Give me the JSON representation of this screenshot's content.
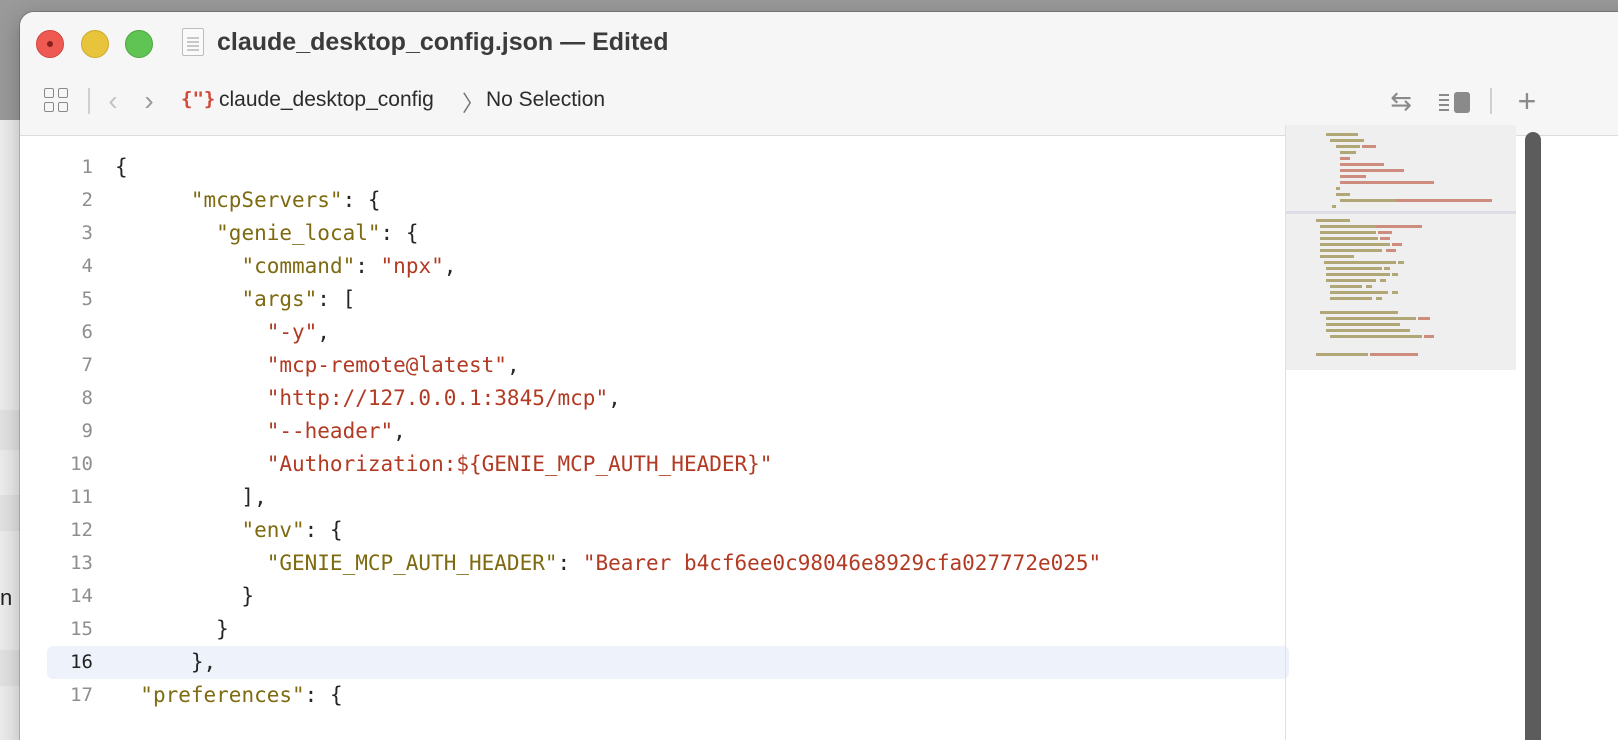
{
  "window": {
    "title": "claude_desktop_config.json — Edited"
  },
  "toolbar": {
    "back_glyph": "‹",
    "forward_glyph": "›",
    "breadcrumb": {
      "file_icon_glyph": "{\"}",
      "file": "claude_desktop_config",
      "separator": "〉",
      "selection": "No Selection"
    },
    "add_glyph": "+",
    "swap_glyph": "⇆"
  },
  "background": {
    "partial_char": "n"
  },
  "editor": {
    "current_line": 16,
    "lines": [
      {
        "n": "1",
        "text": "{"
      },
      {
        "n": "2",
        "text": "      \"mcpServers\": {"
      },
      {
        "n": "3",
        "text": "        \"genie_local\": {"
      },
      {
        "n": "4",
        "text": "          \"command\": \"npx\","
      },
      {
        "n": "5",
        "text": "          \"args\": ["
      },
      {
        "n": "6",
        "text": "            \"-y\","
      },
      {
        "n": "7",
        "text": "            \"mcp-remote@latest\","
      },
      {
        "n": "8",
        "text": "            \"http://127.0.0.1:3845/mcp\","
      },
      {
        "n": "9",
        "text": "            \"--header\","
      },
      {
        "n": "10",
        "text": "            \"Authorization:${GENIE_MCP_AUTH_HEADER}\""
      },
      {
        "n": "11",
        "text": "          ],"
      },
      {
        "n": "12",
        "text": "          \"env\": {"
      },
      {
        "n": "13",
        "text": "            \"GENIE_MCP_AUTH_HEADER\": \"Bearer b4cf6ee0c98046e8929cfa027772e025\""
      },
      {
        "n": "14",
        "text": "          }"
      },
      {
        "n": "15",
        "text": "        }"
      },
      {
        "n": "16",
        "text": "      },"
      },
      {
        "n": "17",
        "text": "  \"preferences\": {"
      }
    ]
  },
  "colors": {
    "key": "#7e6a10",
    "string": "#b23a23",
    "current_line_bg": "#eef2fb",
    "close": "#ee5a52",
    "minimize": "#e8c33c",
    "maximize": "#5fc454"
  }
}
